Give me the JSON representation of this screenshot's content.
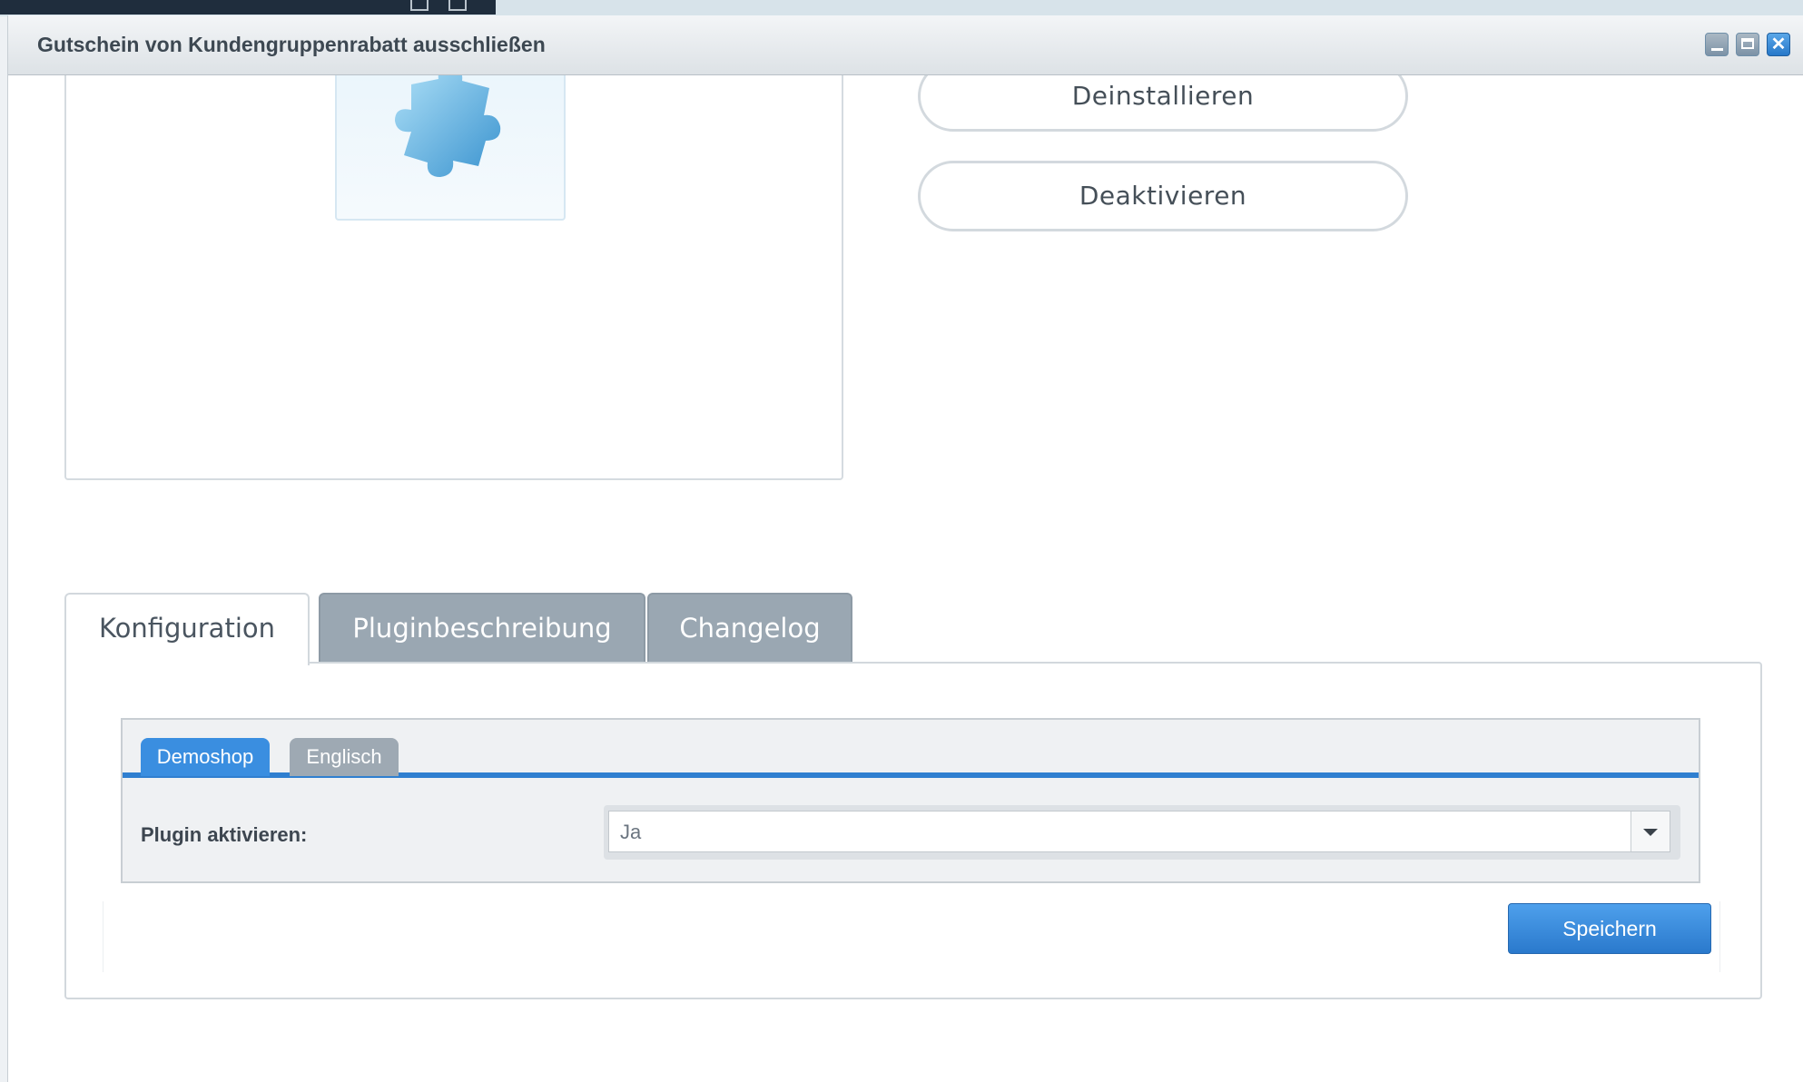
{
  "window": {
    "title": "Gutschein von Kundengruppenrabatt ausschließen",
    "controls": {
      "minimize": "minimize-icon",
      "maximize": "maximize-icon",
      "close": "close-icon"
    }
  },
  "plugin": {
    "image_icon": "puzzle-piece-icon",
    "actions": {
      "uninstall_label": "Deinstallieren",
      "deactivate_label": "Deaktivieren"
    }
  },
  "tabs": [
    {
      "label": "Konfiguration",
      "active": true
    },
    {
      "label": "Pluginbeschreibung",
      "active": false
    },
    {
      "label": "Changelog",
      "active": false
    }
  ],
  "config": {
    "subtabs": [
      {
        "label": "Demoshop",
        "active": true
      },
      {
        "label": "Englisch",
        "active": false
      }
    ],
    "fields": [
      {
        "label": "Plugin aktivieren:",
        "value": "Ja"
      }
    ],
    "save_label": "Speichern"
  },
  "colors": {
    "accent": "#3a8ee0",
    "inactive_tab": "#9aa7b2",
    "title_text": "#3d4852"
  }
}
